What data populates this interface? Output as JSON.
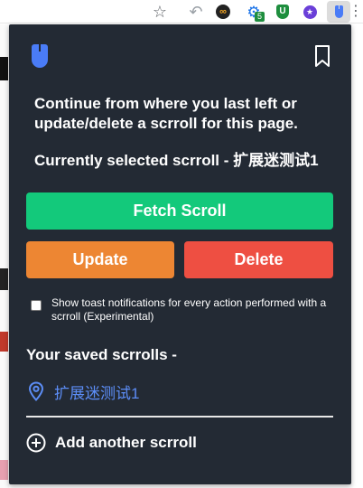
{
  "browser_toolbar": {
    "star_icon": "star-icon",
    "extension_badge_count": "5",
    "extensions": [
      "back-arrow-icon",
      "infinity-icon",
      "gear-icon",
      "shield-icon",
      "star-badge-icon",
      "scrroll-mouse-icon",
      "more-icon"
    ]
  },
  "popup": {
    "intro_text": "Continue from where you last left or update/delete a scrroll for this page.",
    "current_selection_text": "Currently selected scrroll - 扩展迷测试1",
    "buttons": {
      "fetch": "Fetch Scroll",
      "update": "Update",
      "delete": "Delete"
    },
    "toast_option": {
      "label": "Show toast notifications for every action performed with a scrroll (Experimental)",
      "checked": false
    },
    "saved_heading": "Your saved scrrolls -",
    "saved_scrrolls": [
      {
        "label": "扩展迷测试1"
      }
    ],
    "add_label": "Add another scrroll"
  },
  "colors": {
    "popup_bg": "#232a34",
    "fetch": "#13c97b",
    "update": "#ed8633",
    "delete": "#ee4f42",
    "accent_blue": "#4a7cf7",
    "link_blue": "#5c8df6"
  }
}
